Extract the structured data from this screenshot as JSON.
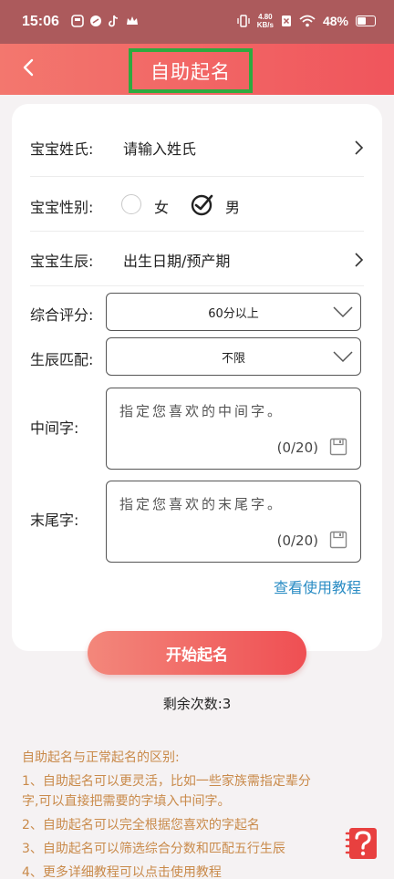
{
  "statusbar": {
    "time": "15:06",
    "net_speed_value": "4.80",
    "net_speed_unit": "KB/s",
    "battery": "48%"
  },
  "header": {
    "title": "自助起名"
  },
  "form": {
    "surname": {
      "label": "宝宝姓氏:",
      "placeholder": "请输入姓氏"
    },
    "gender": {
      "label": "宝宝性别:",
      "options": [
        "女",
        "男"
      ],
      "selected": "男"
    },
    "birth": {
      "label": "宝宝生辰:",
      "value": "出生日期/预产期"
    },
    "score": {
      "label": "综合评分:",
      "value": "60分以上"
    },
    "match": {
      "label": "生辰匹配:",
      "value": "不限"
    },
    "middle_char": {
      "label": "中间字:",
      "placeholder": "指定您喜欢的中间字。",
      "counter": "(0/20)"
    },
    "last_char": {
      "label": "末尾字:",
      "placeholder": "指定您喜欢的末尾字。",
      "counter": "(0/20)"
    },
    "tutorial_link": "查看使用教程"
  },
  "actions": {
    "start_label": "开始起名",
    "remaining": "剩余次数:3"
  },
  "notes": {
    "title": "自助起名与正常起名的区别:",
    "lines": [
      "1、自助起名可以更灵活，比如一些家族需指定辈分",
      "字,可以直接把需要的字填入中间字。",
      "2、自助起名可以完全根据您喜欢的字起名",
      "3、自助起名可以筛选综合分数和匹配五行生辰",
      "4、更多详细教程可以点击使用教程"
    ]
  },
  "colors": {
    "header_start": "#f3776e",
    "header_end": "#f0555c",
    "title_outline": "#2eaa3f",
    "link": "#2a8cc4",
    "notes_text": "#c98a4a"
  }
}
